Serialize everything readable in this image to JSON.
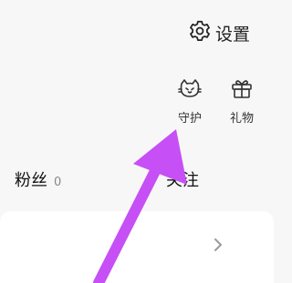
{
  "header": {
    "settings_label": "设置"
  },
  "actions": [
    {
      "label": "守护",
      "icon": "cat-icon"
    },
    {
      "label": "礼物",
      "icon": "gift-icon"
    }
  ],
  "stats": {
    "fans": {
      "label": "粉丝",
      "count": "0"
    },
    "follow": {
      "label": "关注",
      "count": ""
    }
  },
  "colors": {
    "annotation_arrow": "#c64ff5",
    "card_bg": "#ffffff",
    "page_bg": "#f7f7f7"
  }
}
